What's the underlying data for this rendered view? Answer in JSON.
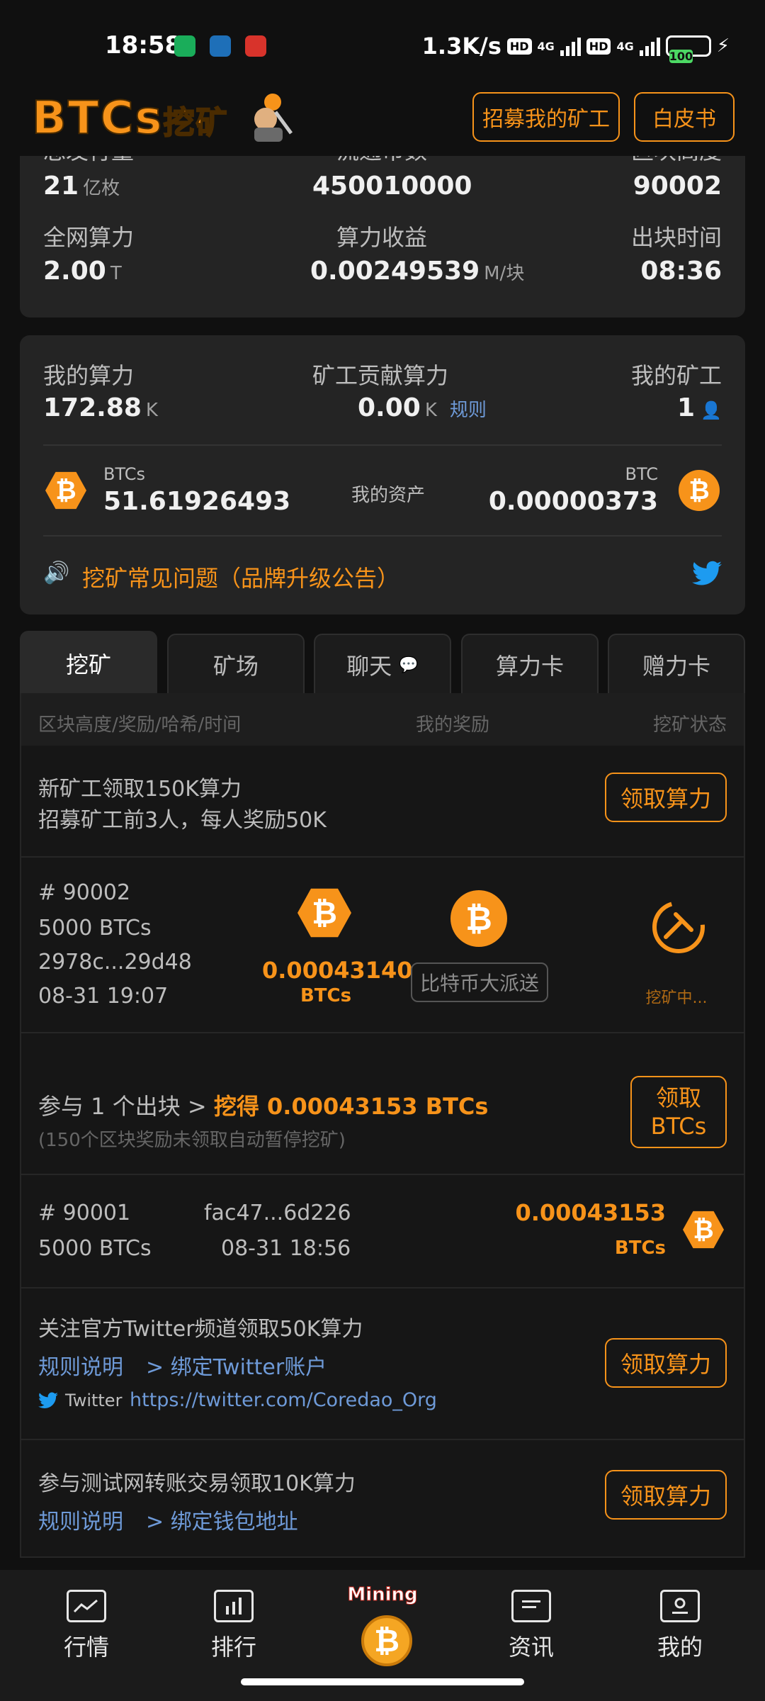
{
  "status": {
    "time": "18:58",
    "net_speed": "1.3K/s",
    "hd1": "HD",
    "hd2": "HD",
    "g1": "4G",
    "g2": "4G",
    "battery": "100"
  },
  "header": {
    "logo": "BTCs",
    "logo_cn": "挖矿",
    "recruit_button": "招募我的矿工",
    "whitepaper_button": "白皮书"
  },
  "stats": {
    "total_supply_label": "总发行量",
    "total_supply_value": "21",
    "total_supply_unit": "亿枚",
    "circulating_label": "流通币数",
    "circulating_value": "450010000",
    "block_height_label": "区块高度",
    "block_height_value": "90002",
    "network_hash_label": "全网算力",
    "network_hash_value": "2.00",
    "network_hash_unit": "T",
    "hash_income_label": "算力收益",
    "hash_income_value": "0.00249539",
    "hash_income_unit": "M/块",
    "block_time_label": "出块时间",
    "block_time_value": "08:36"
  },
  "mine": {
    "my_hash_label": "我的算力",
    "my_hash_value": "172.88",
    "my_hash_unit": "K",
    "contrib_label": "矿工贡献算力",
    "contrib_value": "0.00",
    "contrib_unit": "K",
    "rules_link": "规则",
    "my_miners_label": "我的矿工",
    "my_miners_value": "1",
    "btcs_label": "BTCs",
    "btcs_value": "51.61926493",
    "assets_label": "我的资产",
    "btc_label": "BTC",
    "btc_value": "0.00000373",
    "notice": "挖矿常见问题（品牌升级公告）"
  },
  "tabs": [
    "挖矿",
    "矿场",
    "聊天",
    "算力卡",
    "赠力卡"
  ],
  "list": {
    "head_left": "区块高度/奖励/哈希/时间",
    "head_mid": "我的奖励",
    "head_right": "挖矿状态",
    "new_miner_line1": "新矿工领取150K算力",
    "new_miner_line2": "招募矿工前3人，每人奖励50K",
    "claim_button": "领取算力",
    "block1_height": "# 90002",
    "block1_reward": "5000 BTCs",
    "block1_hash": "2978c...29d48",
    "block1_time": "08-31 19:07",
    "block1_my_reward": "0.00043140",
    "block1_unit": "BTCs",
    "btc_giveaway": "比特币大派送",
    "mining_status": "挖矿中...",
    "participate_prefix": "参与 1 个出块 >",
    "participate_gain": "挖得 0.00043153 BTCs",
    "participate_note": "(150个区块奖励未领取自动暂停挖矿)",
    "claim_btcs_line1": "领取",
    "claim_btcs_line2": "BTCs",
    "block2_height": "# 90001",
    "block2_reward": "5000 BTCs",
    "block2_hash": "fac47...6d226",
    "block2_time": "08-31 18:56",
    "block2_my_reward": "0.00043153",
    "block2_unit": "BTCs",
    "twitter_task": "关注官方Twitter频道领取50K算力",
    "rules_desc": "规则说明",
    "bind_twitter": "> 绑定Twitter账户",
    "twitter_label": "Twitter",
    "twitter_url": "https://twitter.com/Coredao_Org",
    "testnet_task": "参与测试网转账交易领取10K算力",
    "rules_desc2": "规则说明",
    "bind_wallet": "> 绑定钱包地址"
  },
  "nav": {
    "market": "行情",
    "ranking": "排行",
    "mining": "Mining",
    "news": "资讯",
    "mine": "我的"
  }
}
